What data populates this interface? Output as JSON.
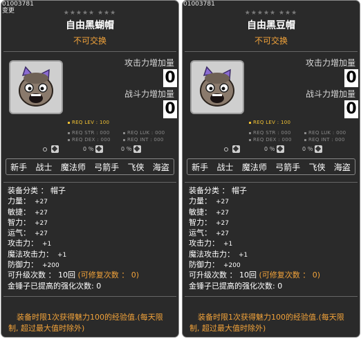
{
  "cards": [
    {
      "item_id": "01003781",
      "sub_label": "变更",
      "stars": "★★★★★ ★★★",
      "name": "自由黑蝴帽",
      "trade": "不可交换",
      "attack_label": "攻击力增加量",
      "attack_value": "0",
      "power_label": "战斗力增加量",
      "power_value": "0",
      "req_lev": "REQ LEV : 100",
      "req_str": "REQ STR : 000",
      "req_luk": "REQ LUK : 000",
      "req_dex": "REQ DEX : 000",
      "req_int": "REQ INT : 000",
      "pct1": "0",
      "pct2": "0 ％",
      "pct3": "0 ％",
      "jobs": [
        "新手",
        "战士",
        "魔法师",
        "弓箭手",
        "飞侠",
        "海盗"
      ],
      "stats": {
        "category": "装备分类 ： 帽子",
        "str_label": "力量：",
        "str_val": "+27",
        "dex_label": "敏捷：",
        "dex_val": "+27",
        "int_label": "智力：",
        "int_val": "+27",
        "luk_label": "运气：",
        "luk_val": "+27",
        "atk_label": "攻击力：",
        "atk_val": "+1",
        "matk_label": "魔法攻击力：",
        "matk_val": "+1",
        "def_label": "防御力：",
        "def_val": "+200",
        "upgrade": "可升级次数 ： 10回",
        "repair": "(可修复次数 ： 0)",
        "hammer": "金锤子已提高的强化次数: 0"
      },
      "description": "装备时限1次获得魅力100的经验值.(每天限制, 超过最大值时除外)"
    },
    {
      "item_id": "01003781",
      "sub_label": "",
      "stars": "★★★★★ ★★★",
      "name": "自由黑豆帽",
      "trade": "不可交换",
      "attack_label": "攻击力增加量",
      "attack_value": "0",
      "power_label": "战斗力增加量",
      "power_value": "0",
      "req_lev": "REQ LEV : 100",
      "req_str": "REQ STR : 000",
      "req_luk": "REQ LUK : 000",
      "req_dex": "REQ DEX : 000",
      "req_int": "REQ INT : 000",
      "pct1": "0",
      "pct2": "0 ％",
      "pct3": "0 ％",
      "jobs": [
        "新手",
        "战士",
        "魔法师",
        "弓箭手",
        "飞侠",
        "海盗"
      ],
      "stats": {
        "category": "装备分类 ： 帽子",
        "str_label": "力量：",
        "str_val": "+27",
        "dex_label": "敏捷：",
        "dex_val": "+27",
        "int_label": "智力：",
        "int_val": "+27",
        "luk_label": "运气：",
        "luk_val": "+27",
        "atk_label": "攻击力：",
        "atk_val": "+1",
        "matk_label": "魔法攻击力：",
        "matk_val": "+1",
        "def_label": "防御力：",
        "def_val": "+200",
        "upgrade": "可升级次数 ： 10回",
        "repair": "(可修复次数 ： 0)",
        "hammer": "金锤子已提高的强化次数: 0"
      },
      "description": "装备时限1次获得魅力100的经验值.(每天限制, 超过最大值时除外)"
    }
  ],
  "colors": {
    "panel": "#2a2a2a",
    "accent_orange": "#f2a33a",
    "req_yellow": "#f2c233"
  },
  "icons": [
    "hat-item-icon",
    "weapon-type-icon",
    "armor-type-icon",
    "shield-type-icon"
  ]
}
